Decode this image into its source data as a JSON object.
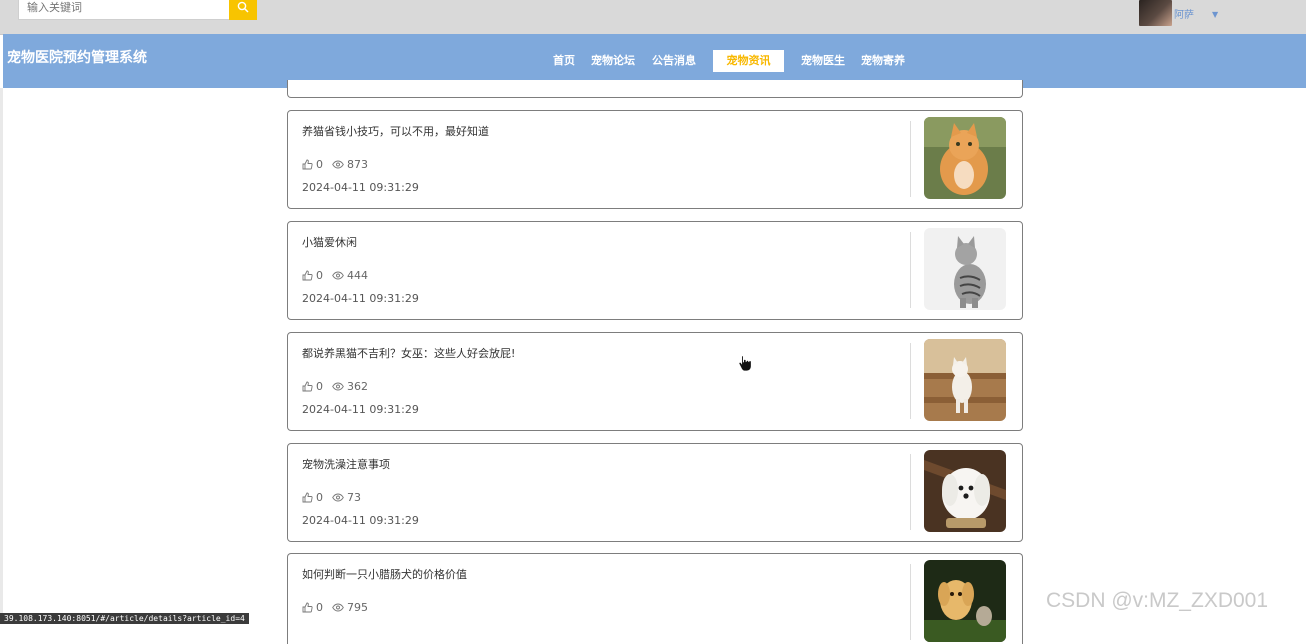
{
  "search": {
    "placeholder": "输入关键词"
  },
  "user": {
    "name": "阿萨"
  },
  "brand": "宠物医院预约管理系统",
  "nav": [
    {
      "label": "首页"
    },
    {
      "label": "宠物论坛"
    },
    {
      "label": "公告消息"
    },
    {
      "label": "宠物资讯",
      "active": true
    },
    {
      "label": "宠物医生"
    },
    {
      "label": "宠物寄养"
    }
  ],
  "articles": [
    {
      "title": "养猫省钱小技巧，可以不用，最好知道",
      "likes": "0",
      "views": "873",
      "date": "2024-04-11 09:31:29",
      "image": "orange-cat-photo"
    },
    {
      "title": "小猫爱休闲",
      "likes": "0",
      "views": "444",
      "date": "2024-04-11 09:31:29",
      "image": "grey-tabby-cat-photo"
    },
    {
      "title": "都说养黑猫不吉利？女巫：这些人好会放屁!",
      "likes": "0",
      "views": "362",
      "date": "2024-04-11 09:31:29",
      "image": "white-cat-on-stairs-photo"
    },
    {
      "title": "宠物洗澡注意事项",
      "likes": "0",
      "views": "73",
      "date": "2024-04-11 09:31:29",
      "image": "white-puppy-photo"
    },
    {
      "title": "如何判断一只小腊肠犬的价格价值",
      "likes": "0",
      "views": "795",
      "date": "",
      "image": "puppy-and-kitten-photo"
    }
  ],
  "status_url": "39.108.173.140:8051/#/article/details?article_id=4",
  "watermark": "CSDN @v:MZ_ZXD001",
  "colors": {
    "nav_bg": "#7fa9dc",
    "accent": "#f8c400",
    "active_text": "#f8b800"
  },
  "icons": {
    "search": "search-icon",
    "like": "thumbs-up-icon",
    "views": "eye-icon",
    "user_menu": "caret-down-icon"
  }
}
